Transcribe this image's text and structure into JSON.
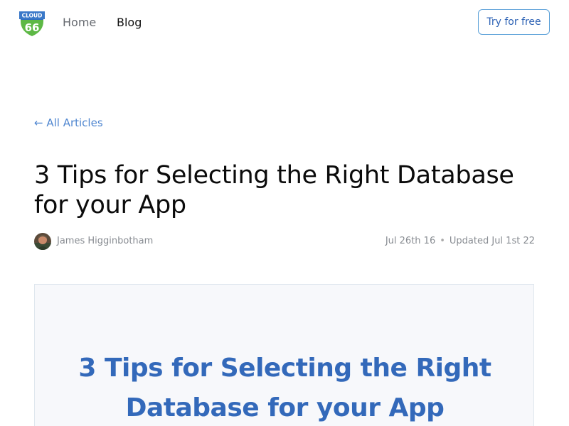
{
  "nav": {
    "logo_top": "CLOUD",
    "logo_num": "66",
    "home": "Home",
    "blog": "Blog",
    "cta": "Try for free"
  },
  "back_link": "← All Articles",
  "article": {
    "title": "3 Tips for Selecting the Right Database for your App",
    "author": "James Higginbotham",
    "published": "Jul 26th 16",
    "separator": "•",
    "updated": "Updated Jul 1st 22"
  },
  "hero": {
    "line1": "3 Tips for Selecting the Right",
    "line2": "Database for your App"
  },
  "colors": {
    "link": "#4f86d0",
    "hero_text": "#3369ba",
    "logo_blue": "#2f6fc0",
    "logo_green": "#5db845"
  }
}
